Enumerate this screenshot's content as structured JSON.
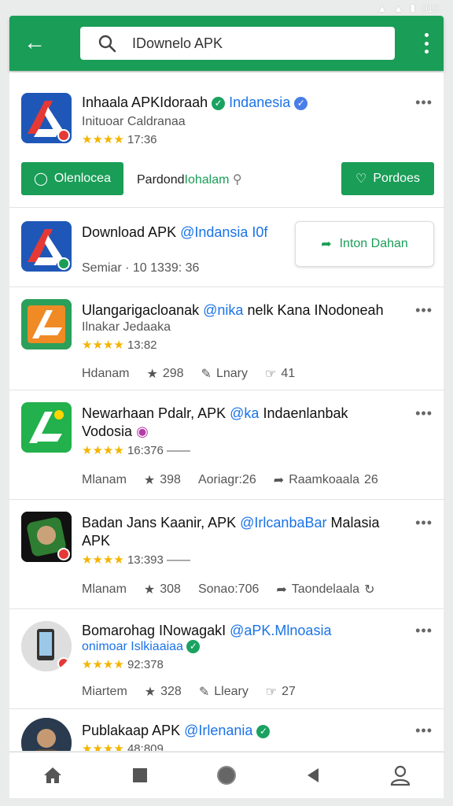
{
  "status": {
    "time": "010"
  },
  "header": {
    "search_value": "IDownelo APK"
  },
  "colors": {
    "brand": "#1a9d57",
    "accent": "#1a73e8",
    "star": "#f4b400"
  },
  "items": [
    {
      "title": "Inhaala APKIdoraah",
      "title_at": "Indanesia",
      "subtitle": "Inituoar Caldranaa",
      "rating": "17:36",
      "button_left": "Olenlocea",
      "middle_text": "Pardond",
      "middle_link": "Iohalam",
      "button_right": "Pordoes"
    },
    {
      "title": "Download APK",
      "title_at": "@Indansia I0f",
      "subtitle": "Semiar · 10 1339: 36",
      "button": "Inton Dahan"
    },
    {
      "title": "Ulangarigacloanak",
      "title_at": "@nika",
      "title_rest": "nelk Kana INodoneah",
      "subtitle": "Ilnakar Jedaaka",
      "rating": "13:82",
      "meta": [
        "Hdanam",
        "298",
        "Lnary",
        "41"
      ]
    },
    {
      "title": "Newarhaan Pdalr, APK",
      "title_at": "@ka",
      "title_rest": "Indaenlanbak",
      "title_line2": "Vodosia",
      "rating": "16:376",
      "meta": [
        "Mlanam",
        "398",
        "Aoriagr:26",
        "Raamkoaala",
        "26"
      ]
    },
    {
      "title": "Badan Jans Kaanir, APK",
      "title_at": "@IrlcanbaBar",
      "title_rest": "Malasia",
      "title_line2": "APK",
      "rating": "13:393",
      "meta": [
        "Mlanam",
        "308",
        "Sonao:706",
        "Taondelaala"
      ]
    },
    {
      "title": "Bomarohag INowagakI",
      "title_at": "@aPK.Mlnoasia",
      "subtitle": "onimoar Islkiaaiaa",
      "rating": "92:378",
      "meta": [
        "Miartem",
        "328",
        "Lleary",
        "27"
      ]
    },
    {
      "title": "Publakaap APK",
      "title_at": "@Irlenania",
      "rating": "48:809"
    }
  ]
}
